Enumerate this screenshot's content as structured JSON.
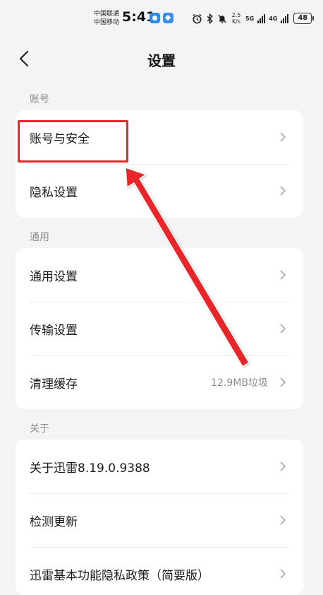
{
  "status_bar": {
    "carrier_1": "中国联通",
    "carrier_2": "中国移动",
    "time": "5:41",
    "speed_value": "2.5",
    "speed_unit": "K/s",
    "net_5g": "5G",
    "net_4g": "4G",
    "battery": "48"
  },
  "header": {
    "title": "设置"
  },
  "sections": {
    "account": {
      "label": "账号",
      "items": [
        {
          "label": "账号与安全"
        },
        {
          "label": "隐私设置"
        }
      ]
    },
    "general": {
      "label": "通用",
      "items": [
        {
          "label": "通用设置"
        },
        {
          "label": "传输设置"
        },
        {
          "label": "清理缓存",
          "value": "12.9MB垃圾"
        }
      ]
    },
    "about": {
      "label": "关于",
      "items": [
        {
          "label": "关于迅雷8.19.0.9388"
        },
        {
          "label": "检测更新"
        },
        {
          "label": "迅雷基本功能隐私政策（简要版）"
        }
      ]
    }
  },
  "colors": {
    "background": "#f4f4f6",
    "card": "#ffffff",
    "highlight": "#e8262c",
    "secondary_text": "#8c8c8c"
  },
  "icons": [
    "back-chevron-icon",
    "chevron-right-icon",
    "alarm-icon",
    "bluetooth-icon",
    "mute-icon",
    "signal-icon",
    "battery-icon"
  ]
}
